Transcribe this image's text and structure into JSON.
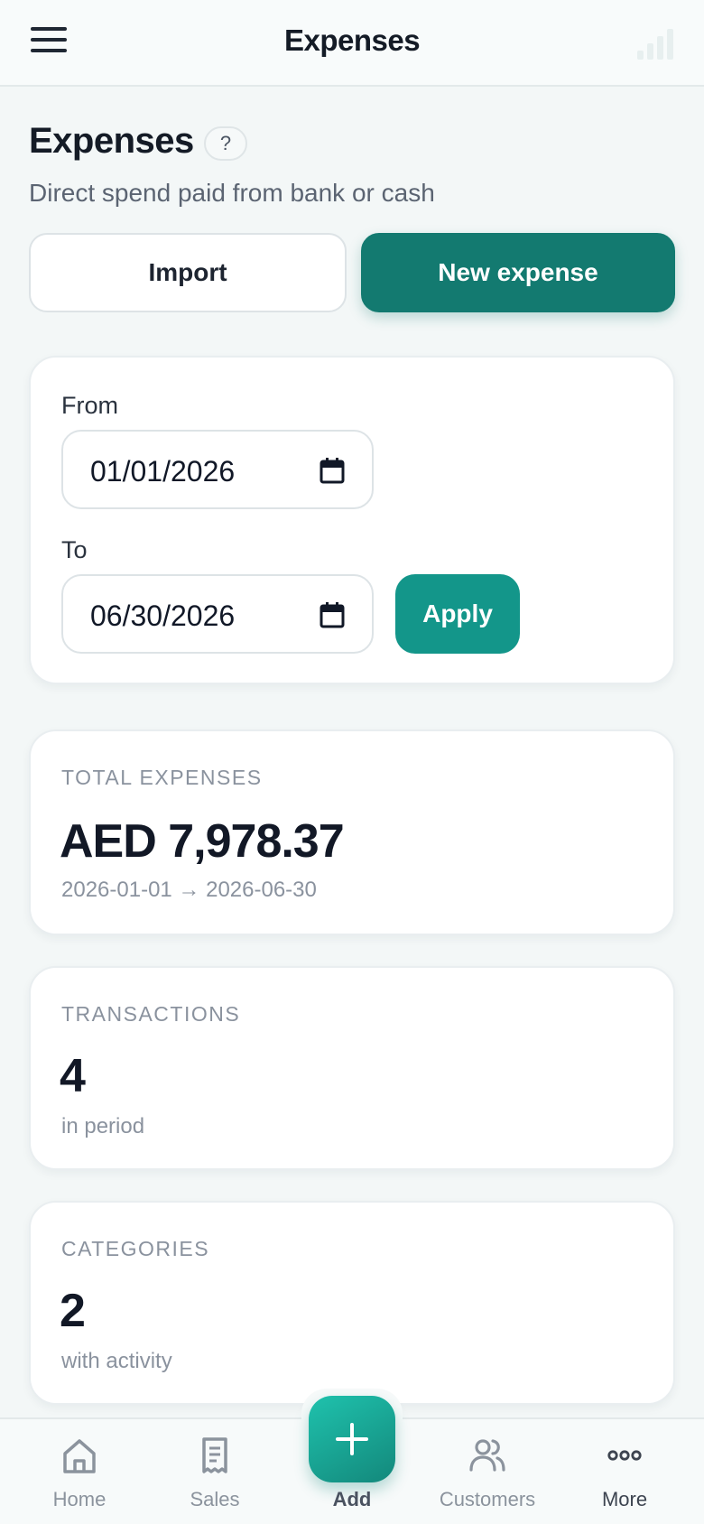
{
  "topbar": {
    "title": "Expenses"
  },
  "header": {
    "title": "Expenses",
    "help": "?",
    "subtitle": "Direct spend paid from bank or cash"
  },
  "actions": {
    "import_label": "Import",
    "new_label": "New expense"
  },
  "filter": {
    "from_label": "From",
    "from_value": "01/01/2026",
    "to_label": "To",
    "to_value": "06/30/2026",
    "apply_label": "Apply"
  },
  "stats": {
    "total": {
      "label": "TOTAL EXPENSES",
      "value": "AED 7,978.37",
      "range": "2026-01-01 → 2026-06-30"
    },
    "transactions": {
      "label": "TRANSACTIONS",
      "value": "4",
      "sub": "in period"
    },
    "categories": {
      "label": "CATEGORIES",
      "value": "2",
      "sub": "with activity"
    }
  },
  "nav": {
    "home": "Home",
    "sales": "Sales",
    "add": "Add",
    "customers": "Customers",
    "more": "More"
  },
  "colors": {
    "primary": "#137a70",
    "apply": "#13968a",
    "fab_start": "#1fc2ad",
    "fab_end": "#13887b",
    "background": "#f3f7f7"
  },
  "icons": {
    "menu": "hamburger-menu-icon",
    "help": "question-icon",
    "calendar": "calendar-icon",
    "home": "home-icon",
    "sales": "receipt-icon",
    "add": "plus-icon",
    "customers": "users-icon",
    "more": "ellipsis-icon"
  }
}
